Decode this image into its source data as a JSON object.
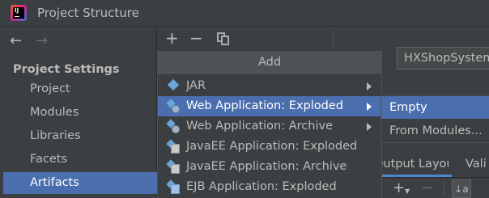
{
  "window": {
    "title": "Project Structure"
  },
  "sidebar": {
    "section_title": "Project Settings",
    "items": [
      {
        "label": "Project",
        "selected": false
      },
      {
        "label": "Modules",
        "selected": false
      },
      {
        "label": "Libraries",
        "selected": false
      },
      {
        "label": "Facets",
        "selected": false
      },
      {
        "label": "Artifacts",
        "selected": true
      }
    ]
  },
  "toolbar": {
    "add_glyph": "+",
    "remove_glyph": "−",
    "back_glyph": "←",
    "forward_glyph": "→"
  },
  "add_menu": {
    "header": "Add",
    "items": [
      {
        "label": "JAR",
        "icon": "jar-icon",
        "has_submenu": true,
        "selected": false
      },
      {
        "label": "Web Application: Exploded",
        "icon": "web-exploded-icon",
        "has_submenu": true,
        "selected": true
      },
      {
        "label": "Web Application: Archive",
        "icon": "web-archive-icon",
        "has_submenu": true,
        "selected": false
      },
      {
        "label": "JavaEE Application: Exploded",
        "icon": "javaee-exploded-icon",
        "has_submenu": false,
        "selected": false
      },
      {
        "label": "JavaEE Application: Archive",
        "icon": "javaee-archive-icon",
        "has_submenu": false,
        "selected": false
      },
      {
        "label": "EJB Application: Exploded",
        "icon": "ejb-exploded-icon",
        "has_submenu": false,
        "selected": false
      }
    ]
  },
  "submenu": {
    "items": [
      {
        "label": "Empty",
        "selected": true
      },
      {
        "label": "From Modules...",
        "selected": false
      }
    ]
  },
  "artifact": {
    "name_value": "HXShopSystem",
    "tabs": {
      "output_layout": "Output Layout",
      "validation": "Vali"
    },
    "bottom_toolbar": {
      "add_glyph": "+",
      "remove_glyph": "−",
      "sort_glyph": "↓a"
    }
  },
  "colors": {
    "selection": "#4b6eaf",
    "background": "#3c3f41",
    "tab_accent": "#4a88c7"
  }
}
